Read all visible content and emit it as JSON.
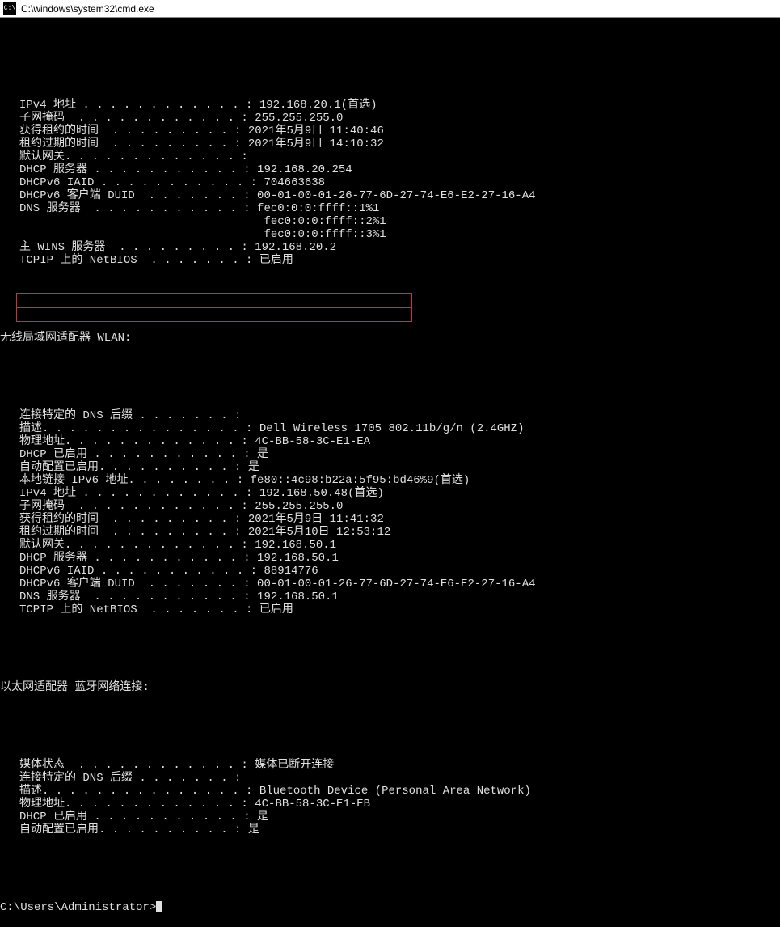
{
  "window": {
    "title": "C:\\windows\\system32\\cmd.exe"
  },
  "block1": {
    "rows": [
      {
        "label": "IPv4 地址 . . . . . . . . . . . . :",
        "value": " 192.168.20.1(首选)"
      },
      {
        "label": "子网掩码  . . . . . . . . . . . . :",
        "value": " 255.255.255.0"
      },
      {
        "label": "获得租约的时间  . . . . . . . . . :",
        "value": " 2021年5月9日 11:40:46"
      },
      {
        "label": "租约过期的时间  . . . . . . . . . :",
        "value": " 2021年5月9日 14:10:32"
      },
      {
        "label": "默认网关. . . . . . . . . . . . . :",
        "value": ""
      },
      {
        "label": "DHCP 服务器 . . . . . . . . . . . :",
        "value": " 192.168.20.254"
      },
      {
        "label": "DHCPv6 IAID . . . . . . . . . . . :",
        "value": " 704663638"
      },
      {
        "label": "DHCPv6 客户端 DUID  . . . . . . . :",
        "value": " 00-01-00-01-26-77-6D-27-74-E6-E2-27-16-A4"
      },
      {
        "label": "DNS 服务器  . . . . . . . . . . . :",
        "value": " fec0:0:0:ffff::1%1"
      },
      {
        "label": "                                   ",
        "value": " fec0:0:0:ffff::2%1"
      },
      {
        "label": "                                   ",
        "value": " fec0:0:0:ffff::3%1"
      },
      {
        "label": "主 WINS 服务器  . . . . . . . . . :",
        "value": " 192.168.20.2"
      },
      {
        "label": "TCPIP 上的 NetBIOS  . . . . . . . :",
        "value": " 已启用"
      }
    ]
  },
  "section2_header": "无线局域网适配器 WLAN:",
  "block2": {
    "rows": [
      {
        "label": "连接特定的 DNS 后缀 . . . . . . . :",
        "value": ""
      },
      {
        "label": "描述. . . . . . . . . . . . . . . :",
        "value": " Dell Wireless 1705 802.11b/g/n (2.4GHZ)"
      },
      {
        "label": "物理地址. . . . . . . . . . . . . :",
        "value": " 4C-BB-58-3C-E1-EA"
      },
      {
        "label": "DHCP 已启用 . . . . . . . . . . . :",
        "value": " 是"
      },
      {
        "label": "自动配置已启用. . . . . . . . . . :",
        "value": " 是"
      },
      {
        "label": "本地链接 IPv6 地址. . . . . . . . :",
        "value": " fe80::4c98:b22a:5f95:bd46%9(首选)"
      },
      {
        "label": "IPv4 地址 . . . . . . . . . . . . :",
        "value": " 192.168.50.48(首选)"
      },
      {
        "label": "子网掩码  . . . . . . . . . . . . :",
        "value": " 255.255.255.0"
      },
      {
        "label": "获得租约的时间  . . . . . . . . . :",
        "value": " 2021年5月9日 11:41:32"
      },
      {
        "label": "租约过期的时间  . . . . . . . . . :",
        "value": " 2021年5月10日 12:53:12"
      },
      {
        "label": "默认网关. . . . . . . . . . . . . :",
        "value": " 192.168.50.1"
      },
      {
        "label": "DHCP 服务器 . . . . . . . . . . . :",
        "value": " 192.168.50.1"
      },
      {
        "label": "DHCPv6 IAID . . . . . . . . . . . :",
        "value": " 88914776"
      },
      {
        "label": "DHCPv6 客户端 DUID  . . . . . . . :",
        "value": " 00-01-00-01-26-77-6D-27-74-E6-E2-27-16-A4"
      },
      {
        "label": "DNS 服务器  . . . . . . . . . . . :",
        "value": " 192.168.50.1"
      },
      {
        "label": "TCPIP 上的 NetBIOS  . . . . . . . :",
        "value": " 已启用"
      }
    ]
  },
  "section3_header": "以太网适配器 蓝牙网络连接:",
  "block3": {
    "rows": [
      {
        "label": "媒体状态  . . . . . . . . . . . . :",
        "value": " 媒体已断开连接"
      },
      {
        "label": "连接特定的 DNS 后缀 . . . . . . . :",
        "value": ""
      },
      {
        "label": "描述. . . . . . . . . . . . . . . :",
        "value": " Bluetooth Device (Personal Area Network)"
      },
      {
        "label": "物理地址. . . . . . . . . . . . . :",
        "value": " 4C-BB-58-3C-E1-EB"
      },
      {
        "label": "DHCP 已启用 . . . . . . . . . . . :",
        "value": " 是"
      },
      {
        "label": "自动配置已启用. . . . . . . . . . :",
        "value": " 是"
      }
    ]
  },
  "prompt": "C:\\Users\\Administrator>"
}
